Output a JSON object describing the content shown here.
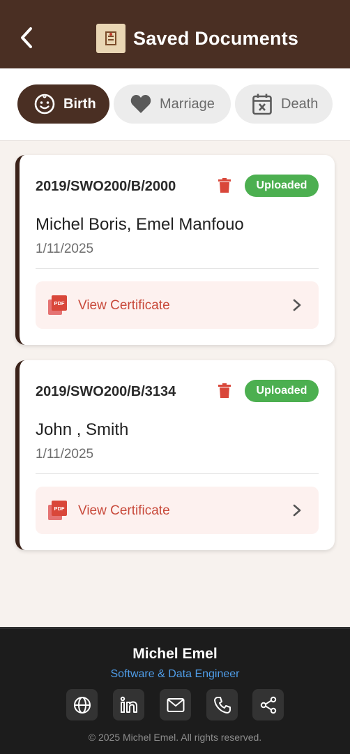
{
  "header": {
    "title": "Saved Documents",
    "back_icon": "arrow-back-icon",
    "logo_icon": "app-logo"
  },
  "tabs": [
    {
      "label": "Birth",
      "icon": "baby-face-icon",
      "active": true
    },
    {
      "label": "Marriage",
      "icon": "heart-icon",
      "active": false
    },
    {
      "label": "Death",
      "icon": "calendar-x-icon",
      "active": false
    }
  ],
  "documents": [
    {
      "reference": "2019/SWO200/B/2000",
      "status": "Uploaded",
      "names": "Michel Boris, Emel Manfouo",
      "date": "1/11/2025",
      "action_label": "View Certificate"
    },
    {
      "reference": "2019/SWO200/B/3134",
      "status": "Uploaded",
      "names": "John , Smith",
      "date": "1/11/2025",
      "action_label": "View Certificate"
    }
  ],
  "footer": {
    "name": "Michel Emel",
    "role": "Software & Data Engineer",
    "social_icons": [
      "globe-icon",
      "linkedin-icon",
      "mail-icon",
      "phone-icon",
      "share-icon"
    ],
    "copyright": "© 2025 Michel Emel. All rights reserved."
  },
  "colors": {
    "primary_brown": "#4a2f23",
    "success_green": "#4caf50",
    "danger_red": "#d9473a",
    "link_blue": "#4f9de8"
  }
}
